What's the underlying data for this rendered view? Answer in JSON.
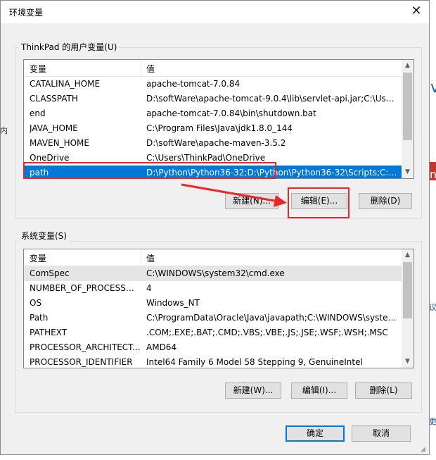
{
  "window": {
    "title": "环境变量",
    "close": "✕"
  },
  "user_vars": {
    "group_label": "ThinkPad 的用户变量(U)",
    "columns": [
      "变量",
      "值"
    ],
    "rows": [
      {
        "name": "CATALINA_HOME",
        "value": "apache-tomcat-7.0.84"
      },
      {
        "name": "CLASSPATH",
        "value": "D:\\softWare\\apache-tomcat-9.0.4\\lib\\servlet-api.jar;C:\\Users\\..."
      },
      {
        "name": "end",
        "value": " apache-tomcat-7.0.84\\bin\\shutdown.bat"
      },
      {
        "name": "JAVA_HOME",
        "value": "C:\\Program Files\\Java\\jdk1.8.0_144"
      },
      {
        "name": "MAVEN_HOME",
        "value": "D:\\softWare\\apache-maven-3.5.2"
      },
      {
        "name": "OneDrive",
        "value": "C:\\Users\\ThinkPad\\OneDrive"
      },
      {
        "name": "path",
        "value": "D:\\Python\\Python36-32;D:\\Python\\Python36-32\\Scripts;C:\\Use..."
      }
    ],
    "selected_index": 6,
    "buttons": {
      "new": "新建(N)...",
      "edit": "编辑(E)...",
      "delete": "删除(D)"
    }
  },
  "system_vars": {
    "group_label": "系统变量(S)",
    "columns": [
      "变量",
      "值"
    ],
    "rows": [
      {
        "name": "ComSpec",
        "value": "C:\\WINDOWS\\system32\\cmd.exe"
      },
      {
        "name": "NUMBER_OF_PROCESSORS",
        "value": "4"
      },
      {
        "name": "OS",
        "value": "Windows_NT"
      },
      {
        "name": "Path",
        "value": "C:\\ProgramData\\Oracle\\Java\\javapath;C:\\WINDOWS\\system3..."
      },
      {
        "name": "PATHEXT",
        "value": ".COM;.EXE;.BAT;.CMD;.VBS;.VBE;.JS;.JSE;.WSF;.WSH;.MSC"
      },
      {
        "name": "PROCESSOR_ARCHITECT...",
        "value": "AMD64"
      },
      {
        "name": "PROCESSOR_IDENTIFIER",
        "value": "Intel64 Family 6 Model 58 Stepping 9, GenuineIntel"
      }
    ],
    "highlighted_index": 0,
    "buttons": {
      "new": "新建(W)...",
      "edit": "编辑(I)...",
      "delete": "删除(L)"
    }
  },
  "footer": {
    "ok": "确定",
    "cancel": "取消"
  },
  "background_fragments": {
    "left_char": "内",
    "right_v": "v",
    "right_n": "n",
    "right_kuo": "议",
    "right_geng": "更"
  },
  "colors": {
    "selection": "#0078d7",
    "annotation": "#e8282b"
  }
}
